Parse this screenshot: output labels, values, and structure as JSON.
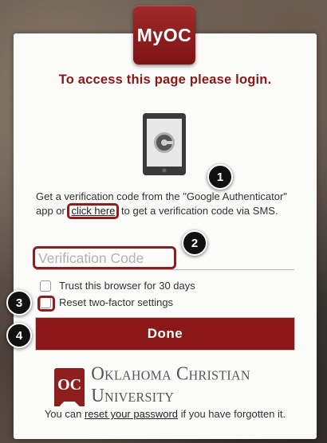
{
  "app": {
    "logo_text": "MyOC",
    "heading": "To access this page please login."
  },
  "instructions": {
    "before_link": "Get a verification code from the \"Google Authenticator\" app or ",
    "link_text": "click here",
    "after_link": " to get a verification code via SMS."
  },
  "verification": {
    "placeholder": "Verification Code",
    "value": ""
  },
  "options": {
    "trust_label": "Trust this browser for 30 days",
    "trust_checked": false,
    "reset_label": "Reset two-factor settings",
    "reset_checked": false
  },
  "actions": {
    "done_label": "Done"
  },
  "branding": {
    "oc_mark": "OC",
    "university_name": "Oklahoma Christian University"
  },
  "footer": {
    "before_link": "You can ",
    "link_text": "reset your password",
    "after_link": " if you have forgotten it."
  },
  "markers": [
    "1",
    "2",
    "3",
    "4"
  ],
  "colors": {
    "brand": "#8b1717",
    "heading": "#8d1616",
    "highlight": "#8b1e1e"
  },
  "icons": {
    "device": "smartphone-authenticator-icon"
  }
}
